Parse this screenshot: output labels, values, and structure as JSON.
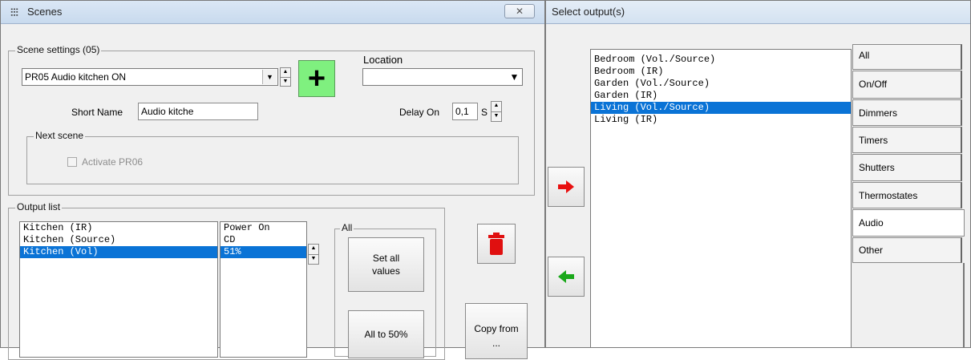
{
  "scenes_window": {
    "title": "Scenes",
    "close_glyph": "✕",
    "scene_settings": {
      "legend": "Scene settings (05)",
      "scene_select_value": "PR05 Audio kitchen ON",
      "add_glyph": "+",
      "location_label": "Location",
      "location_value": "",
      "short_name_label": "Short Name",
      "short_name_value": "Audio kitche",
      "delay_on_label": "Delay On",
      "delay_on_value": "0,1",
      "delay_unit": "S"
    },
    "next_scene": {
      "legend": "Next scene",
      "activate_label": "Activate PR06"
    },
    "output_list": {
      "legend": "Output list",
      "outputs": [
        "Kitchen (IR)",
        "Kitchen (Source)",
        "Kitchen (Vol)"
      ],
      "values": [
        "Power On",
        "CD",
        "51%"
      ],
      "selected_index": 2
    },
    "all_group": {
      "legend": "All",
      "set_all_label": "Set all values",
      "all_50_label": "All to 50%"
    },
    "copy_from_label": "Copy from ..."
  },
  "select_window": {
    "title": "Select output(s)",
    "outputs": [
      "Bedroom (Vol./Source)",
      "Bedroom (IR)",
      "Garden (Vol./Source)",
      "Garden (IR)",
      "Living (Vol./Source)",
      "Living (IR)"
    ],
    "selected_index": 4,
    "tabs": [
      "All",
      "On/Off",
      "Dimmers",
      "Timers",
      "Shutters",
      "Thermostates",
      "Audio",
      "Other"
    ],
    "active_tab": "Audio"
  },
  "colors": {
    "add_button": "#7ff07f",
    "selection": "#0a73d6",
    "add_arrow": "#e81010",
    "remove_arrow": "#1aa81a",
    "trash": "#e01010"
  }
}
